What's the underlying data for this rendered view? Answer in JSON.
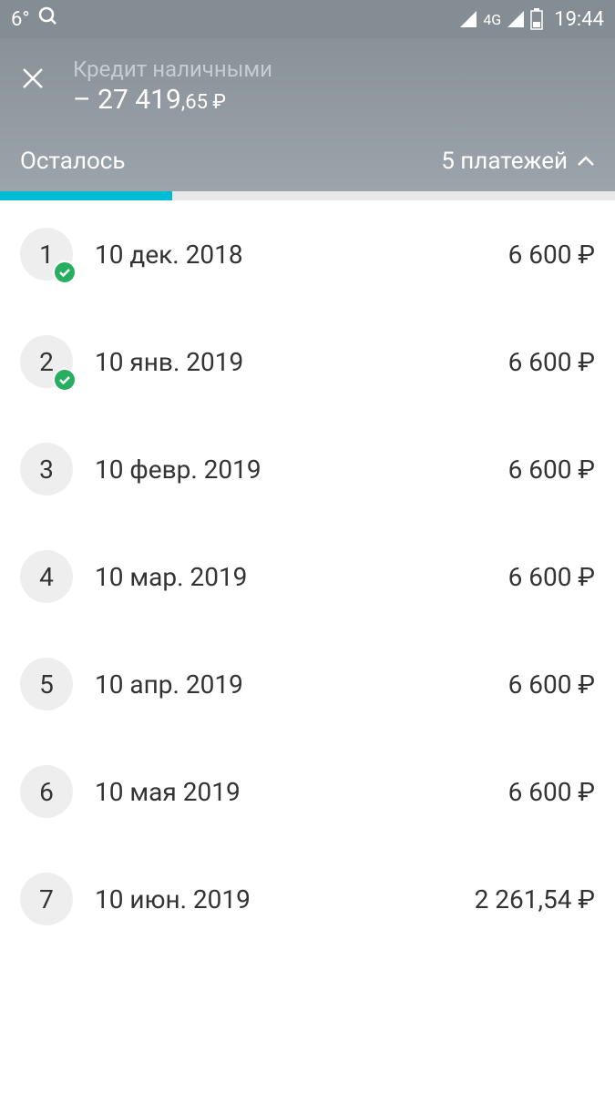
{
  "statusBar": {
    "temperature": "6°",
    "network": "4G",
    "time": "19:44"
  },
  "header": {
    "title": "Кредит наличными",
    "amountPrefix": "– 27 419",
    "amountSuffix": ",65 ₽",
    "remainingLabel": "Осталось",
    "paymentsToggle": "5 платежей"
  },
  "payments": [
    {
      "number": "1",
      "date": "10 дек. 2018",
      "amount": "6 600 ₽",
      "paid": true
    },
    {
      "number": "2",
      "date": "10 янв. 2019",
      "amount": "6 600 ₽",
      "paid": true
    },
    {
      "number": "3",
      "date": "10 февр. 2019",
      "amount": "6 600 ₽",
      "paid": false
    },
    {
      "number": "4",
      "date": "10 мар. 2019",
      "amount": "6 600 ₽",
      "paid": false
    },
    {
      "number": "5",
      "date": "10 апр. 2019",
      "amount": "6 600 ₽",
      "paid": false
    },
    {
      "number": "6",
      "date": "10 мая 2019",
      "amount": "6 600 ₽",
      "paid": false
    },
    {
      "number": "7",
      "date": "10 июн. 2019",
      "amount": "2 261,54 ₽",
      "paid": false
    }
  ]
}
